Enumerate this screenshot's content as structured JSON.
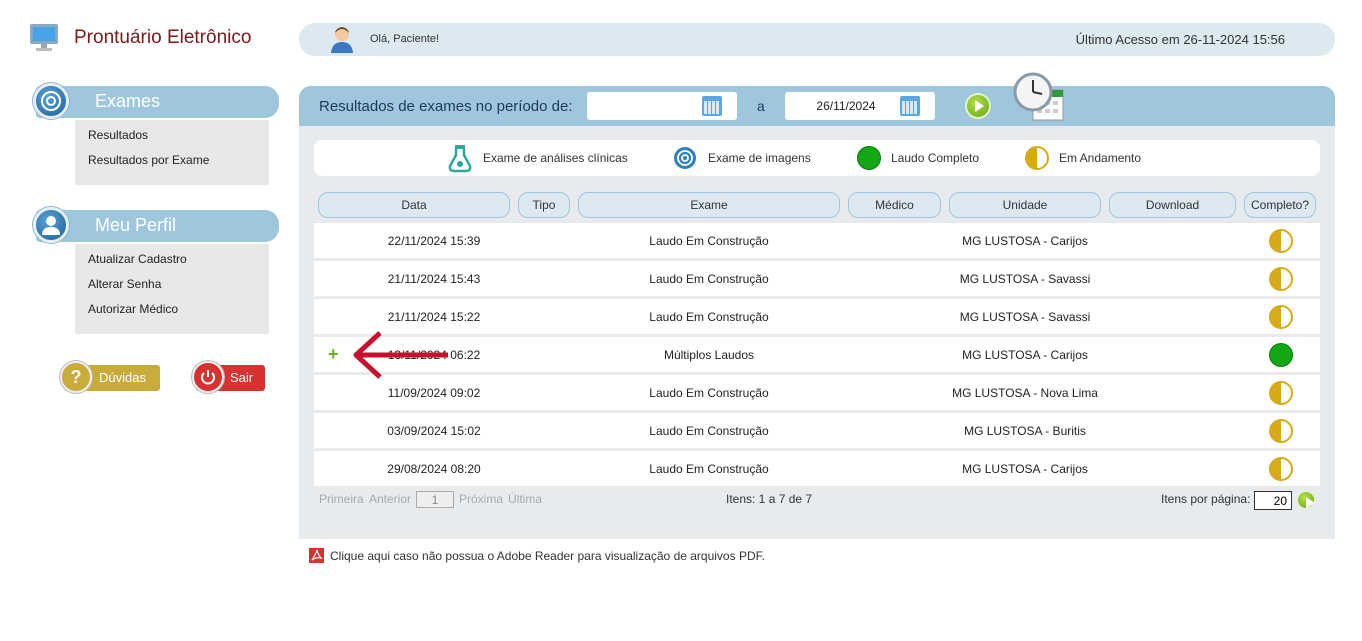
{
  "brand": {
    "title": "Prontuário Eletrônico",
    "icon": "computer-monitor-icon"
  },
  "topbar": {
    "greeting": "Olá, Paciente!",
    "last_access": "Último Acesso em 26-11-2024 15:56",
    "avatar_icon": "user-avatar-icon"
  },
  "sidebar": {
    "exames": {
      "title": "Exames",
      "icon": "exam-disc-icon",
      "items": [
        {
          "label": "Resultados"
        },
        {
          "label": "Resultados por Exame"
        }
      ]
    },
    "perfil": {
      "title": "Meu Perfil",
      "icon": "profile-icon",
      "items": [
        {
          "label": "Atualizar Cadastro"
        },
        {
          "label": "Alterar Senha"
        },
        {
          "label": "Autorizar Médico"
        }
      ]
    },
    "duvidas_label": "Dúvidas",
    "sair_label": "Sair"
  },
  "filter": {
    "label": "Resultados de exames no período de:",
    "date_from": "",
    "separator": "a",
    "date_to": "26/11/2024"
  },
  "legend": {
    "clinical": "Exame de análises clínicas",
    "imaging": "Exame de imagens",
    "complete": "Laudo Completo",
    "in_progress": "Em Andamento"
  },
  "colors": {
    "complete": "#13a713",
    "in_progress": "#d6aa18",
    "header_blue": "#9ec6dd",
    "brand_red": "#7a1a1a"
  },
  "columns": [
    "Data",
    "Tipo",
    "Exame",
    "Médico",
    "Unidade",
    "Download",
    "Completo?"
  ],
  "rows": [
    {
      "date": "22/11/2024 15:39",
      "exam": "Laudo Em Construção",
      "unit": "MG LUSTOSA - Carijos",
      "status": "in_progress"
    },
    {
      "date": "21/11/2024 15:43",
      "exam": "Laudo Em Construção",
      "unit": "MG LUSTOSA - Savassi",
      "status": "in_progress"
    },
    {
      "date": "21/11/2024 15:22",
      "exam": "Laudo Em Construção",
      "unit": "MG LUSTOSA - Savassi",
      "status": "in_progress"
    },
    {
      "date": "13/11/2024 06:22",
      "exam": "Múltiplos Laudos",
      "unit": "MG LUSTOSA - Carijos",
      "status": "complete",
      "expandable": true
    },
    {
      "date": "11/09/2024 09:02",
      "exam": "Laudo Em Construção",
      "unit": "MG LUSTOSA - Nova Lima",
      "status": "in_progress"
    },
    {
      "date": "03/09/2024 15:02",
      "exam": "Laudo Em Construção",
      "unit": "MG LUSTOSA - Buritis",
      "status": "in_progress"
    },
    {
      "date": "29/08/2024 08:20",
      "exam": "Laudo Em Construção",
      "unit": "MG LUSTOSA - Carijos",
      "status": "in_progress"
    }
  ],
  "pager": {
    "first": "Primeira",
    "prev": "Anterior",
    "page": "1",
    "next": "Próxima",
    "last": "Última",
    "items_info": "Itens: 1 a 7 de 7",
    "per_page_label": "Itens por página:",
    "per_page_value": "20"
  },
  "pdf_note": "Clique aqui caso não possua o Adobe Reader para visualização de arquivos PDF."
}
